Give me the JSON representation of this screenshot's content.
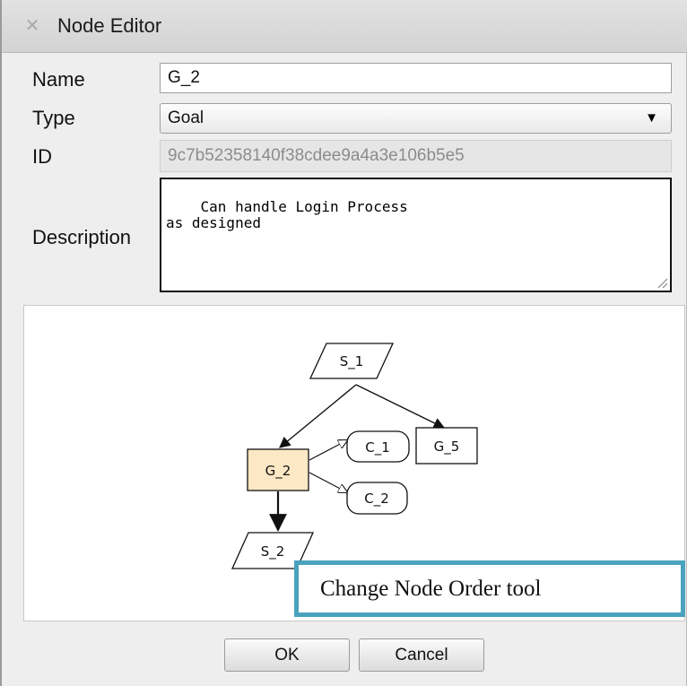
{
  "window": {
    "title": "Node Editor"
  },
  "form": {
    "name_label": "Name",
    "name_value": "G_2",
    "type_label": "Type",
    "type_value": "Goal",
    "id_label": "ID",
    "id_value": "9c7b52358140f38cdee9a4a3e106b5e5",
    "description_label": "Description",
    "description_value": "Can handle Login Process\nas designed"
  },
  "diagram": {
    "nodes": {
      "s1": "S_1",
      "g2": "G_2",
      "c1": "C_1",
      "g5": "G_5",
      "c2": "C_2",
      "s2": "S_2"
    },
    "selected_fill": "#fce8c4"
  },
  "buttons": {
    "ok": "OK",
    "cancel": "Cancel"
  },
  "callout": {
    "text": "Change Node Order tool",
    "border_color": "#4aa3bd"
  }
}
